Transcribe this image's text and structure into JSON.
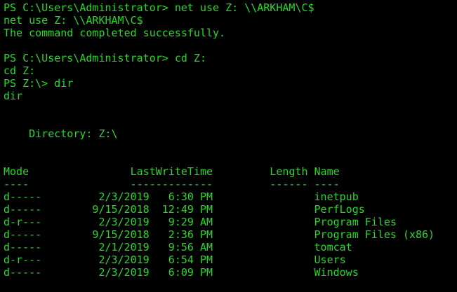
{
  "terminal": {
    "fg_color": "#26d826",
    "bg_color": "#000000",
    "lines": [
      "PS C:\\Users\\Administrator> net use Z: \\\\ARKHAM\\C$",
      "net use Z: \\\\ARKHAM\\C$",
      "The command completed successfully.",
      "",
      "PS C:\\Users\\Administrator> cd Z:",
      "cd Z:",
      "PS Z:\\> dir",
      "dir",
      "",
      "",
      "    Directory: Z:\\",
      "",
      "",
      "Mode                LastWriteTime         Length Name",
      "----                -------------         ------ ----",
      "d-----         2/3/2019   6:30 PM                inetpub",
      "d-----        9/15/2018  12:49 PM                PerfLogs",
      "d-r---         2/3/2019   9:29 AM                Program Files",
      "d-----        9/15/2018   2:36 PM                Program Files (x86)",
      "d-----         2/1/2019   9:56 AM                tomcat",
      "d-r---         2/3/2019   6:54 PM                Users",
      "d-----         2/3/2019   6:09 PM                Windows"
    ]
  }
}
